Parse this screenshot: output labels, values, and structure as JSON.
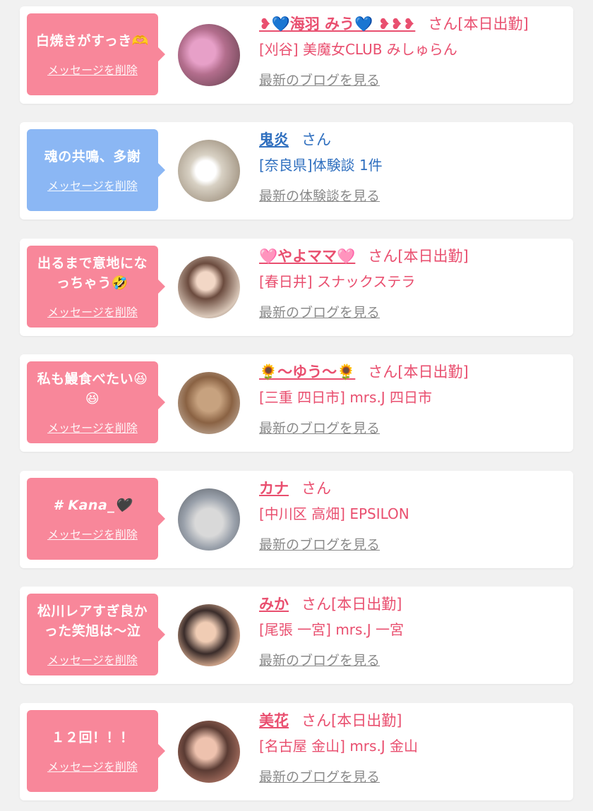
{
  "colors": {
    "pink_accent": "#e94f6f",
    "pink_bubble": "#f8879a",
    "blue_accent": "#2f6fbf",
    "blue_bubble": "#8bb7f4",
    "link_gray": "#8a8a8a"
  },
  "delete_label": "メッセージを削除",
  "items": [
    {
      "theme": "pink",
      "message": "白焼きがすっき🫶",
      "name": "❥💙海羽 みう💙 ❥❥❥",
      "suffix": "さん[本日出勤]",
      "shop": "[刈谷] 美魔女CLUB みしゅらん",
      "link": "最新のブログを見る",
      "avatar": "avatar-photo"
    },
    {
      "theme": "blue",
      "message": "魂の共鳴、多謝",
      "name": "鬼炎",
      "suffix": "さん",
      "shop": "[奈良県]体験談 1件",
      "link": "最新の体験談を見る",
      "avatar": "avatar-photo"
    },
    {
      "theme": "pink",
      "message": "出るまで意地にな\nっちゃう🤣",
      "name": "🩷やよママ🩷",
      "suffix": "さん[本日出勤]",
      "shop": "[春日井] スナックステラ",
      "link": "最新のブログを見る",
      "avatar": "avatar-photo"
    },
    {
      "theme": "pink",
      "message": "私も鰻食べたい😆\n😆",
      "name": "🌻〜ゆう〜🌻",
      "suffix": "さん[本日出勤]",
      "shop": "[三重 四日市] mrs.J 四日市",
      "link": "最新のブログを見る",
      "avatar": "avatar-photo"
    },
    {
      "theme": "pink",
      "message": "# Kana_🖤",
      "name": "カナ",
      "suffix": "さん",
      "shop": "[中川区 高畑] EPSILON",
      "link": "最新のブログを見る",
      "avatar": "avatar-photo"
    },
    {
      "theme": "pink",
      "message": "松川レアすぎ良か\nった笑旭は〜泣",
      "name": "みか",
      "suffix": "さん[本日出勤]",
      "shop": "[尾張 一宮] mrs.J 一宮",
      "link": "最新のブログを見る",
      "avatar": "avatar-photo"
    },
    {
      "theme": "pink",
      "message": "１２回！！！",
      "name": "美花",
      "suffix": "さん[本日出勤]",
      "shop": "[名古屋 金山] mrs.J 金山",
      "link": "最新のブログを見る",
      "avatar": "avatar-photo"
    }
  ]
}
